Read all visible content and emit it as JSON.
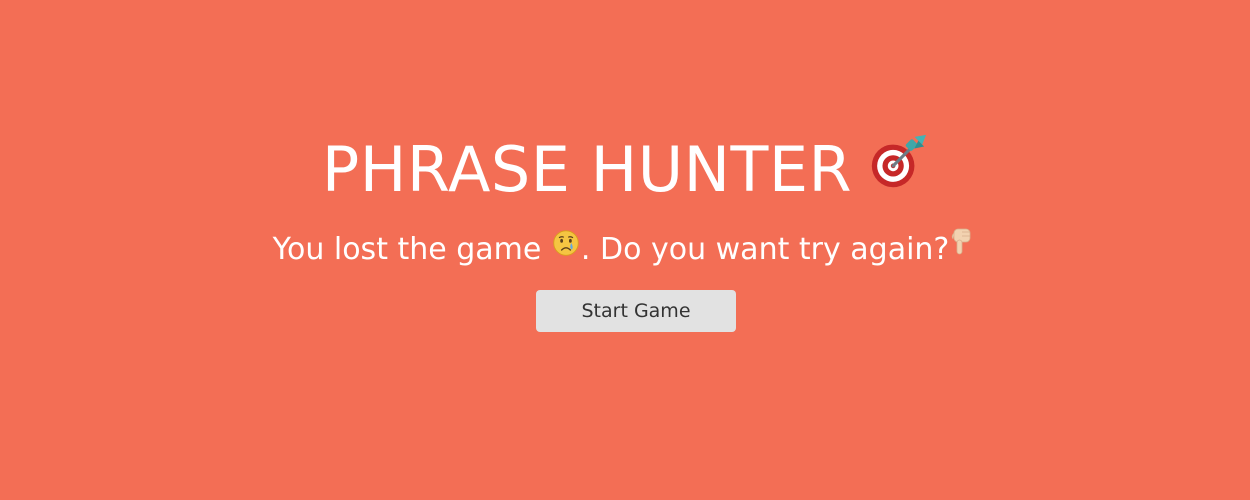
{
  "overlay": {
    "title": "PHRASE HUNTER",
    "title_icon": "dart-target-icon",
    "message_part1": "You lost the game",
    "message_icon1": "crying-face-icon",
    "message_part2": ". Do you want try again?",
    "message_icon2": "pointing-down-icon",
    "button_label": "Start Game"
  },
  "colors": {
    "background": "#f36e55",
    "text": "#ffffff",
    "button_bg": "#e2e2e2",
    "button_text": "#333333"
  }
}
